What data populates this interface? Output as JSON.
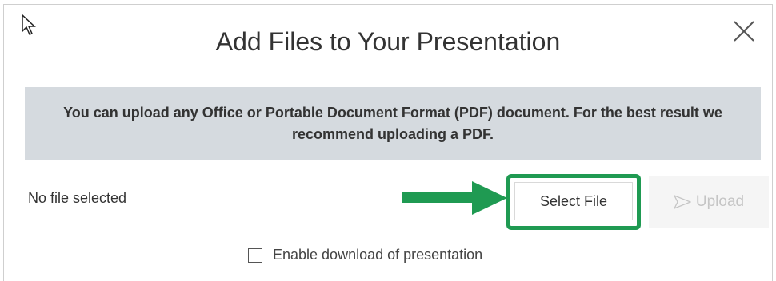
{
  "dialog": {
    "title": "Add Files to Your Presentation",
    "close_icon": "close-icon",
    "info_text": "You can upload any Office or Portable Document Format (PDF) document.  For the best result we recommend uploading a PDF.",
    "file_status": "No file selected",
    "select_file_label": "Select File",
    "upload_label": "Upload",
    "upload_icon": "send-arrow-icon",
    "download_checkbox_label": "Enable download of presentation",
    "download_checkbox_checked": false
  },
  "annotation": {
    "arrow_icon": "green-arrow-icon",
    "highlight_color": "#1f9a52"
  },
  "colors": {
    "banner_bg": "#d5dadf",
    "text": "#333333",
    "disabled_text": "#c5c5c5"
  }
}
